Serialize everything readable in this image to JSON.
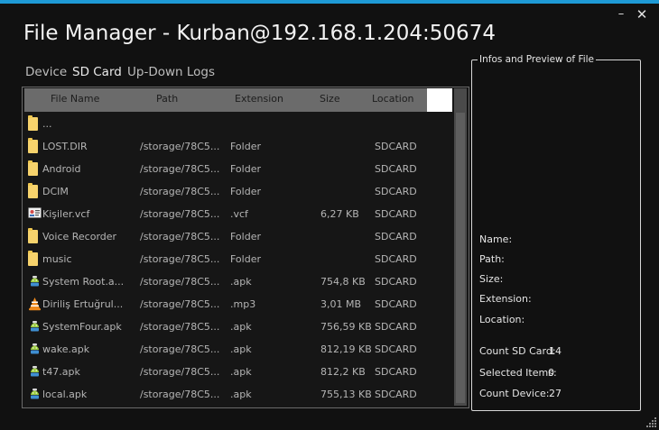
{
  "window": {
    "title": "File Manager - Kurban@192.168.1.204:50674",
    "minimize_glyph": "–",
    "close_glyph": "✕",
    "accent_color": "#1e9ad6"
  },
  "tabs": [
    {
      "label": "Device",
      "active": false
    },
    {
      "label": "SD Card",
      "active": true
    },
    {
      "label": "Up-Down Logs",
      "active": false
    }
  ],
  "grid": {
    "columns": [
      "File Name",
      "Path",
      "Extension",
      "Size",
      "Location"
    ],
    "rows": [
      {
        "icon": "folder-icon",
        "name": "...",
        "path": "",
        "ext": "",
        "size": "",
        "loc": ""
      },
      {
        "icon": "folder-icon",
        "name": "LOST.DIR",
        "path": "/storage/78C5...",
        "ext": "Folder",
        "size": "",
        "loc": "SDCARD"
      },
      {
        "icon": "folder-icon",
        "name": "Android",
        "path": "/storage/78C5...",
        "ext": "Folder",
        "size": "",
        "loc": "SDCARD"
      },
      {
        "icon": "folder-icon",
        "name": "DCIM",
        "path": "/storage/78C5...",
        "ext": "Folder",
        "size": "",
        "loc": "SDCARD"
      },
      {
        "icon": "vcard-icon",
        "name": "Kişiler.vcf",
        "path": "/storage/78C5...",
        "ext": ".vcf",
        "size": "6,27 KB",
        "loc": "SDCARD"
      },
      {
        "icon": "folder-icon",
        "name": "Voice Recorder",
        "path": "/storage/78C5...",
        "ext": "Folder",
        "size": "",
        "loc": "SDCARD"
      },
      {
        "icon": "folder-icon",
        "name": "music",
        "path": "/storage/78C5...",
        "ext": "Folder",
        "size": "",
        "loc": "SDCARD"
      },
      {
        "icon": "apk-icon",
        "name": "System Root.a...",
        "path": "/storage/78C5...",
        "ext": ".apk",
        "size": "754,8 KB",
        "loc": "SDCARD"
      },
      {
        "icon": "vlc-icon",
        "name": "Diriliş Ertuğrul...",
        "path": "/storage/78C5...",
        "ext": ".mp3",
        "size": "3,01 MB",
        "loc": "SDCARD"
      },
      {
        "icon": "apk-icon",
        "name": "SystemFour.apk",
        "path": "/storage/78C5...",
        "ext": ".apk",
        "size": "756,59 KB",
        "loc": "SDCARD"
      },
      {
        "icon": "apk-icon",
        "name": "wake.apk",
        "path": "/storage/78C5...",
        "ext": ".apk",
        "size": "812,19 KB",
        "loc": "SDCARD"
      },
      {
        "icon": "apk-icon",
        "name": "t47.apk",
        "path": "/storage/78C5...",
        "ext": ".apk",
        "size": "812,2 KB",
        "loc": "SDCARD"
      },
      {
        "icon": "apk-icon",
        "name": "local.apk",
        "path": "/storage/78C5...",
        "ext": ".apk",
        "size": "755,13 KB",
        "loc": "SDCARD"
      }
    ]
  },
  "info_panel": {
    "title": "Infos and Preview of File",
    "name_label": "Name:",
    "path_label": "Path:",
    "size_label": "Size:",
    "extension_label": "Extension:",
    "location_label": "Location:",
    "count_sd_label": "Count SD Card:",
    "count_sd_value": "14",
    "selected_label": "Selected Items:",
    "selected_value": "0",
    "count_device_label": "Count Device:",
    "count_device_value": "27"
  }
}
